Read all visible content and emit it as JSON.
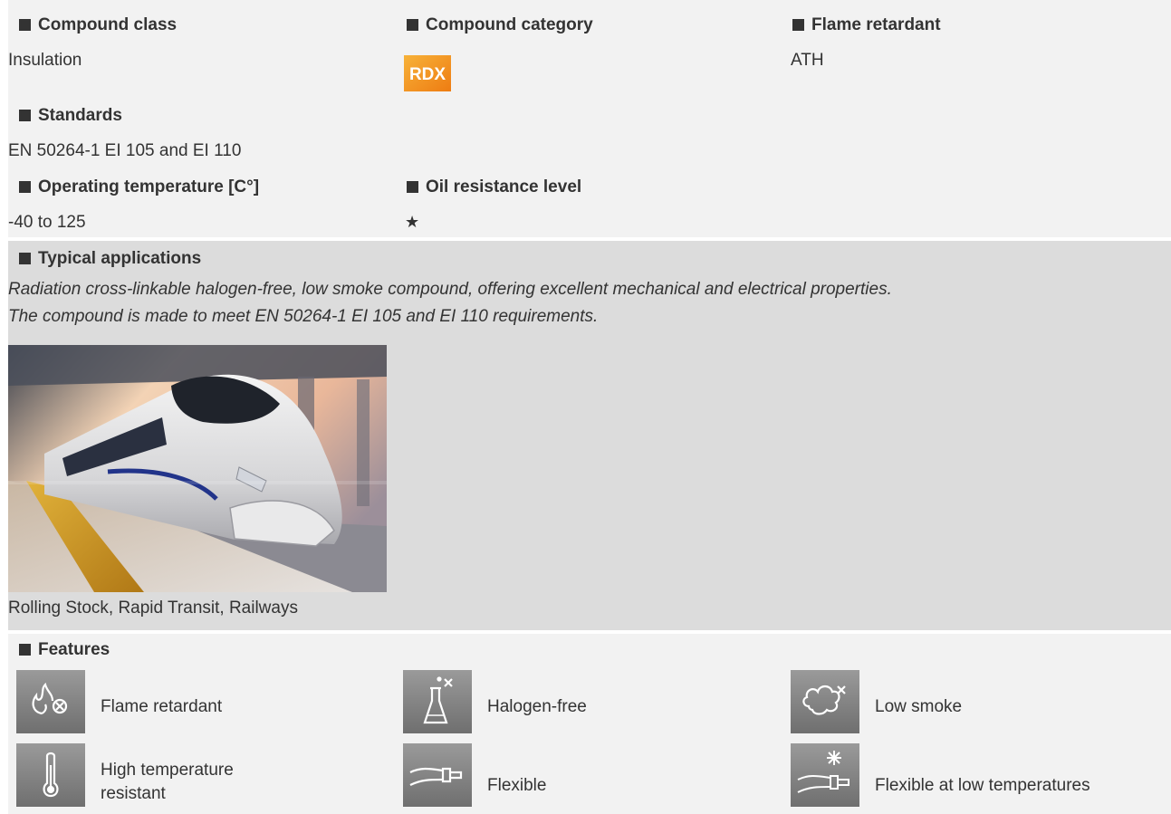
{
  "properties": {
    "compound_class": {
      "label": "Compound class",
      "value": "Insulation"
    },
    "compound_category": {
      "label": "Compound category",
      "badge_text": "RDX",
      "badge_color": "#f39a1d"
    },
    "flame_retardant": {
      "label": "Flame retardant",
      "value": "ATH"
    },
    "standards": {
      "label": "Standards",
      "value": "EN 50264-1 EI 105 and EI 110"
    },
    "operating_temperature": {
      "label": "Operating temperature [C°]",
      "value": "-40 to 125"
    },
    "oil_resistance": {
      "label": "Oil resistance level",
      "stars": "★",
      "level": 1
    }
  },
  "applications": {
    "label": "Typical applications",
    "description_lines": [
      "Radiation cross-linkable halogen-free, low smoke compound, offering excellent mechanical and electrical properties.",
      "The compound is made to meet EN 50264-1 EI 105 and EI 110 requirements."
    ],
    "caption": "Rolling Stock, Rapid Transit, Railways"
  },
  "features": {
    "label": "Features",
    "items": [
      {
        "icon": "flame-retardant-icon",
        "label": "Flame retardant"
      },
      {
        "icon": "halogen-free-icon",
        "label": "Halogen-free"
      },
      {
        "icon": "low-smoke-icon",
        "label": "Low smoke"
      },
      {
        "icon": "thermometer-icon",
        "label_lines": [
          "High temperature",
          "resistant"
        ]
      },
      {
        "icon": "flexible-cable-icon",
        "label": "Flexible"
      },
      {
        "icon": "flexible-low-temperature-icon",
        "label": "Flexible at low temperatures"
      }
    ]
  },
  "colors": {
    "band_light": "#f2f2f2",
    "band_dark": "#dcdcdc",
    "text": "#333333",
    "icon_tile": "#808080"
  }
}
